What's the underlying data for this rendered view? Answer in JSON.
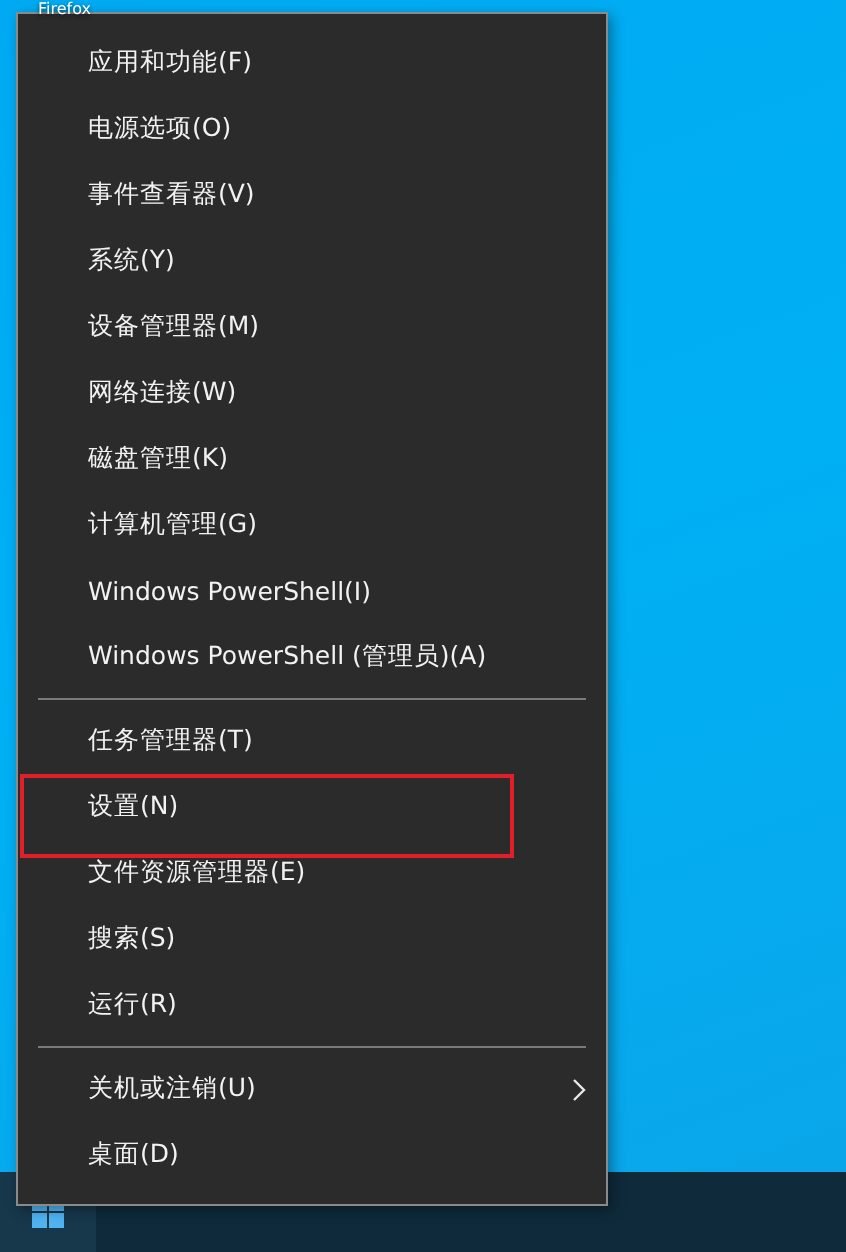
{
  "desktop": {
    "icon_label": "Firefox"
  },
  "menu": {
    "groups": [
      {
        "items": [
          {
            "label": "应用和功能(F)",
            "highlighted": false,
            "has_submenu": false
          },
          {
            "label": "电源选项(O)",
            "highlighted": false,
            "has_submenu": false
          },
          {
            "label": "事件查看器(V)",
            "highlighted": false,
            "has_submenu": false
          },
          {
            "label": "系统(Y)",
            "highlighted": false,
            "has_submenu": false
          },
          {
            "label": "设备管理器(M)",
            "highlighted": false,
            "has_submenu": false
          },
          {
            "label": "网络连接(W)",
            "highlighted": false,
            "has_submenu": false
          },
          {
            "label": "磁盘管理(K)",
            "highlighted": false,
            "has_submenu": false
          },
          {
            "label": "计算机管理(G)",
            "highlighted": false,
            "has_submenu": false
          },
          {
            "label": "Windows PowerShell(I)",
            "highlighted": false,
            "has_submenu": false
          },
          {
            "label": "Windows PowerShell (管理员)(A)",
            "highlighted": false,
            "has_submenu": false
          }
        ]
      },
      {
        "items": [
          {
            "label": "任务管理器(T)",
            "highlighted": false,
            "has_submenu": false
          },
          {
            "label": "设置(N)",
            "highlighted": true,
            "has_submenu": false
          },
          {
            "label": "文件资源管理器(E)",
            "highlighted": false,
            "has_submenu": false
          },
          {
            "label": "搜索(S)",
            "highlighted": false,
            "has_submenu": false
          },
          {
            "label": "运行(R)",
            "highlighted": false,
            "has_submenu": false
          }
        ]
      },
      {
        "items": [
          {
            "label": "关机或注销(U)",
            "highlighted": false,
            "has_submenu": true
          },
          {
            "label": "桌面(D)",
            "highlighted": false,
            "has_submenu": false
          }
        ]
      }
    ]
  }
}
